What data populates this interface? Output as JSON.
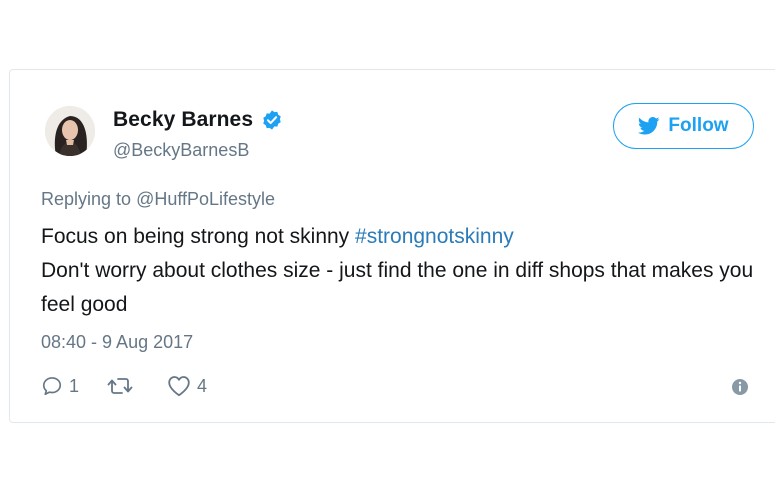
{
  "user": {
    "display_name": "Becky Barnes",
    "handle": "@BeckyBarnesB",
    "verified": true,
    "avatar_icon": "profile-photo"
  },
  "follow_button": {
    "label": "Follow",
    "icon": "twitter-bird-icon"
  },
  "reply": {
    "prefix": "Replying to ",
    "to_handle": "@HuffPoLifestyle"
  },
  "tweet": {
    "line1_text": "Focus on being strong not skinny ",
    "line1_hashtag": "#strongnotskinny",
    "line2": "Don't worry about clothes size - just find the one in diff shops that makes you feel good"
  },
  "timestamp": "08:40 - 9 Aug 2017",
  "actions": {
    "reply_count": "1",
    "retweet_count": "",
    "like_count": "4"
  },
  "colors": {
    "accent": "#1da1f2",
    "hashtag": "#2b7bb9",
    "muted": "#657786",
    "text": "#14171a"
  }
}
